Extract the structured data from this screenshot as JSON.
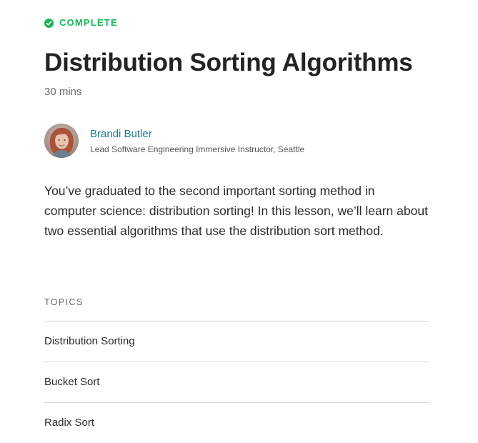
{
  "lesson": {
    "status": {
      "label": "COMPLETE",
      "icon": "check-circle-icon",
      "color": "#16b55a"
    },
    "title": "Distribution Sorting Algorithms",
    "duration": "30 mins",
    "author": {
      "name": "Brandi Butler",
      "role": "Lead Software Engineering Immersive Instructor, Seattle",
      "avatar": "instructor-avatar-photo"
    },
    "description": "You’ve graduated to the second important sorting method in computer science: distribution sorting! In this lesson, we’ll learn about two essential algorithms that use the distribution sort method."
  },
  "topics": {
    "heading": "TOPICS",
    "items": [
      {
        "label": "Distribution Sorting"
      },
      {
        "label": "Bucket Sort"
      },
      {
        "label": "Radix Sort"
      }
    ]
  },
  "colors": {
    "accent_link": "#137b8a",
    "complete_green": "#16b55a",
    "divider": "#d6d6d6"
  }
}
